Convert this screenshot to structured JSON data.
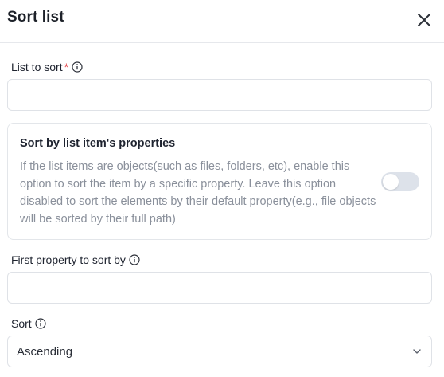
{
  "dialog": {
    "title": "Sort list",
    "close_icon": "close-icon"
  },
  "list_to_sort": {
    "label": "List to sort",
    "required_marker": "*",
    "value": ""
  },
  "sort_by_properties": {
    "title": "Sort by list item's properties",
    "description": "If the list items are objects(such as files, folders, etc), enable this option to sort the item by a specific property. Leave this option disabled to sort the elements by their default property(e.g., file objects will be sorted by their full path)",
    "enabled": false
  },
  "first_property": {
    "label": "First property to sort by",
    "value": ""
  },
  "sort": {
    "label": "Sort",
    "selected": "Ascending"
  },
  "colors": {
    "required": "#e5484d",
    "description_text": "#8a909b",
    "toggle_off": "#dde2ea",
    "border": "#dfe2e7"
  }
}
